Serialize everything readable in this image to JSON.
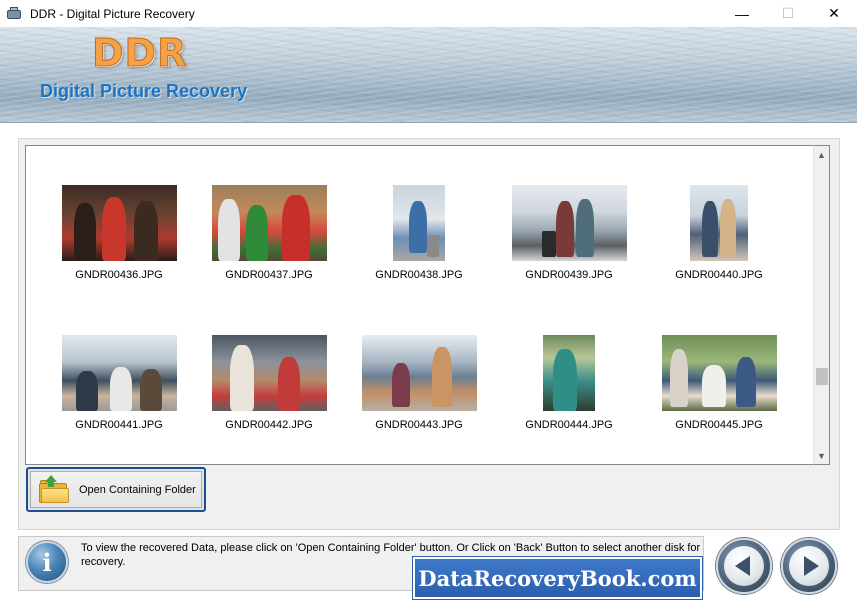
{
  "window": {
    "title": "DDR - Digital Picture Recovery",
    "minimize_glyph": "—",
    "maximize_glyph": "☐",
    "close_glyph": "✕"
  },
  "banner": {
    "logo": "DDR",
    "subtitle": "Digital Picture Recovery"
  },
  "files": [
    {
      "name": "GNDR00436.JPG"
    },
    {
      "name": "GNDR00437.JPG"
    },
    {
      "name": "GNDR00438.JPG"
    },
    {
      "name": "GNDR00439.JPG"
    },
    {
      "name": "GNDR00440.JPG"
    },
    {
      "name": "GNDR00441.JPG"
    },
    {
      "name": "GNDR00442.JPG"
    },
    {
      "name": "GNDR00443.JPG"
    },
    {
      "name": "GNDR00444.JPG"
    },
    {
      "name": "GNDR00445.JPG"
    }
  ],
  "actions": {
    "open_folder_label": "Open Containing Folder"
  },
  "info": {
    "icon_glyph": "i",
    "message": "To view the recovered Data, please click on 'Open Containing Folder' button. Or Click on 'Back' Button to select another disk for recovery."
  },
  "watermark": {
    "text": "DataRecoveryBook.com"
  },
  "scrollbar": {
    "up_glyph": "▲",
    "down_glyph": "▼"
  }
}
